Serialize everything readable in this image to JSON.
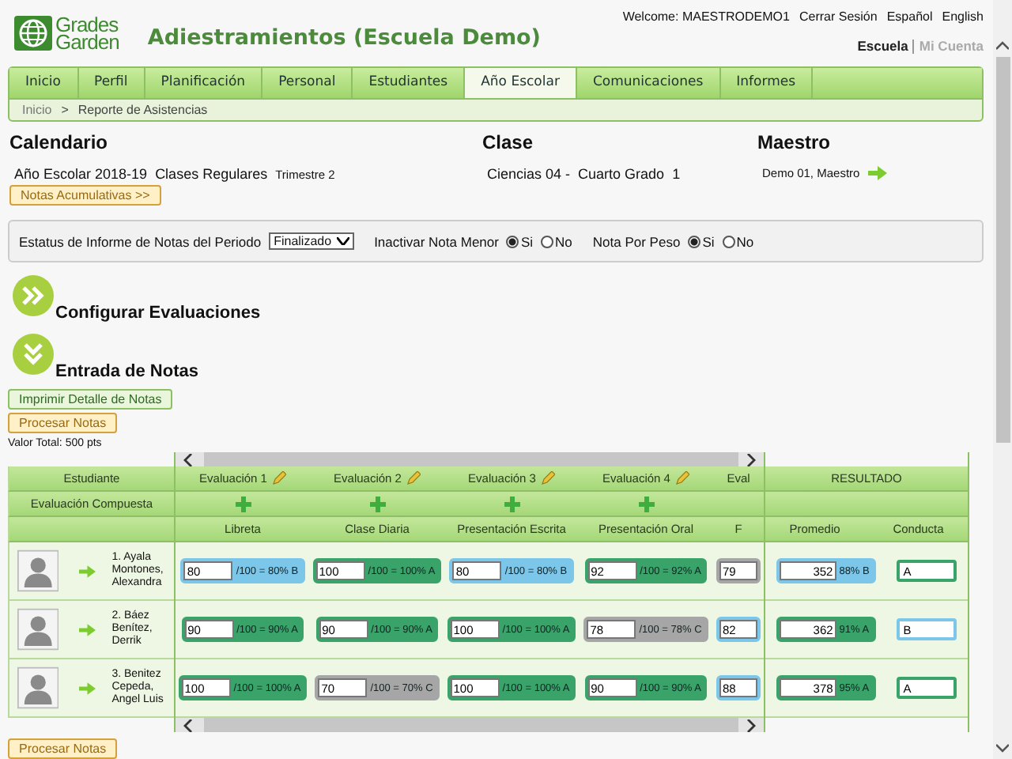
{
  "header": {
    "logo": [
      "Grades",
      "Garden"
    ],
    "title": "Adiestramientos (Escuela Demo)",
    "user_links": [
      "Welcome: MAESTRODEMO1",
      "Cerrar Sesión",
      "Español",
      "English"
    ],
    "context_links": [
      {
        "label": "Escuela",
        "selected": true
      },
      {
        "label": "Mi Cuenta",
        "selected": false
      }
    ]
  },
  "tabs": [
    {
      "label": "Inicio",
      "selected": false
    },
    {
      "label": "Perfil",
      "selected": false
    },
    {
      "label": "Planificación",
      "selected": false
    },
    {
      "label": "Personal",
      "selected": false
    },
    {
      "label": "Estudiantes",
      "selected": false
    },
    {
      "label": "Año Escolar",
      "selected": true
    },
    {
      "label": "Comunicaciones",
      "selected": false
    },
    {
      "label": "Informes",
      "selected": false
    }
  ],
  "breadcrumb": {
    "items": [
      "Inicio",
      "Reporte de Asistencias"
    ],
    "separator": ">"
  },
  "info": {
    "calendario": {
      "heading": "Calendario",
      "parts": [
        "Año Escolar 2018-19",
        "Clases Regulares",
        "Trimestre 2"
      ],
      "button": "Notas Acumulativas >>"
    },
    "clase": {
      "heading": "Clase",
      "parts": [
        "Ciencias 04 -",
        "Cuarto Grado",
        "1"
      ]
    },
    "maestro": {
      "heading": "Maestro",
      "name": "Demo 01, Maestro"
    }
  },
  "filters": {
    "status_label": "Estatus de Informe de Notas del Periodo",
    "status_value": "Finalizado",
    "radios": [
      {
        "label": "Inactivar Nota Menor",
        "options": [
          {
            "label": "Si",
            "selected": true
          },
          {
            "label": "No",
            "selected": false
          }
        ]
      },
      {
        "label": "Nota Por Peso",
        "options": [
          {
            "label": "Si",
            "selected": true
          },
          {
            "label": "No",
            "selected": false
          }
        ]
      }
    ]
  },
  "sections": [
    {
      "title": "Configurar Evaluaciones",
      "expanded": false
    },
    {
      "title": "Entrada de Notas",
      "expanded": true
    }
  ],
  "actions": {
    "print": "Imprimir Detalle de Notas",
    "process": "Procesar Notas",
    "total": "Valor Total: 500 pts",
    "process_bottom": "Procesar Notas"
  },
  "grades": {
    "student_header": "Estudiante",
    "composite_header": "Evaluación Compuesta",
    "result_header": "RESULTADO",
    "result_columns": [
      "Promedio",
      "Conducta"
    ],
    "evaluations": [
      {
        "title": "Evaluación 1",
        "type": "Libreta",
        "partial": false
      },
      {
        "title": "Evaluación 2",
        "type": "Clase Diaria",
        "partial": false
      },
      {
        "title": "Evaluación 3",
        "type": "Presentación Escrita",
        "partial": false
      },
      {
        "title": "Evaluación 4",
        "type": "Presentación Oral",
        "partial": false
      },
      {
        "title": "Eval",
        "type": "F",
        "partial": true
      }
    ],
    "students": [
      {
        "name": "1. Ayala Montones, Alexandra",
        "scores": [
          {
            "value": "80",
            "result": "/100 = 80% B",
            "color": "#7cc6ea"
          },
          {
            "value": "100",
            "result": "/100 = 100% A",
            "color": "#3aa36a"
          },
          {
            "value": "80",
            "result": "/100 = 80% B",
            "color": "#7cc6ea"
          },
          {
            "value": "92",
            "result": "/100 = 92% A",
            "color": "#3aa36a"
          },
          {
            "value": "79",
            "color": "#a6a6a6"
          }
        ],
        "average": {
          "value": "352",
          "result": "88% B",
          "color": "#7cc6ea"
        },
        "conduct": {
          "value": "A",
          "color": "#3aa36a"
        }
      },
      {
        "name": "2. Báez Benítez, Derrik",
        "scores": [
          {
            "value": "90",
            "result": "/100 = 90% A",
            "color": "#3aa36a"
          },
          {
            "value": "90",
            "result": "/100 = 90% A",
            "color": "#3aa36a"
          },
          {
            "value": "100",
            "result": "/100 = 100% A",
            "color": "#3aa36a"
          },
          {
            "value": "78",
            "result": "/100 = 78% C",
            "color": "#a6a6a6"
          },
          {
            "value": "82",
            "color": "#7cc6ea"
          }
        ],
        "average": {
          "value": "362",
          "result": "91% A",
          "color": "#3aa36a"
        },
        "conduct": {
          "value": "B",
          "color": "#7cc6ea"
        }
      },
      {
        "name": "3. Benitez Cepeda, Angel Luis",
        "scores": [
          {
            "value": "100",
            "result": "/100 = 100% A",
            "color": "#3aa36a"
          },
          {
            "value": "70",
            "result": "/100 = 70% C",
            "color": "#a6a6a6"
          },
          {
            "value": "100",
            "result": "/100 = 100% A",
            "color": "#3aa36a"
          },
          {
            "value": "90",
            "result": "/100 = 90% A",
            "color": "#3aa36a"
          },
          {
            "value": "88",
            "color": "#7cc6ea"
          }
        ],
        "average": {
          "value": "378",
          "result": "95% A",
          "color": "#3aa36a"
        },
        "conduct": {
          "value": "A",
          "color": "#3aa36a"
        }
      }
    ]
  }
}
